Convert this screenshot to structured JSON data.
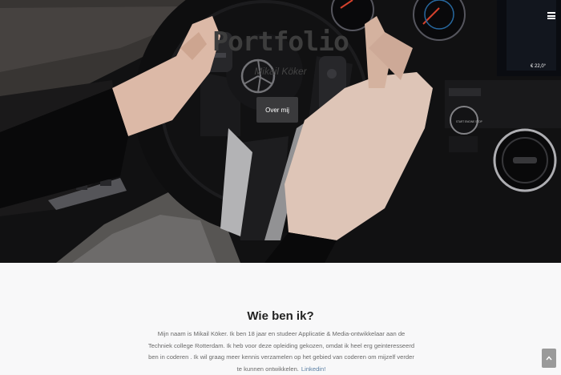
{
  "hero": {
    "title": "Portfolio",
    "subtitle": "Mikail Köker",
    "button_label": "Over mij",
    "menu_icon": "hamburger-icon"
  },
  "about": {
    "heading": "Wie ben ik?",
    "text": "Mijn naam is Mikail Köker. Ik ben 18 jaar en studeer Applicatie & Media-ontwikkelaar aan de Techniek college Rotterdam. Ik heb voor deze opleiding gekozen, omdat ik heel erg geinteresseerd ben in coderen . Ik wil graag meer kennis verzamelen op het gebied van coderen om mijzelf verder te kunnen ontwikkelen.",
    "link_label": "Linkedin!"
  },
  "dashboard": {
    "temperature": "€ 22,0°",
    "start_button": "START ENGINE STOP"
  },
  "scroll_top_icon": "chevron-up-icon",
  "colors": {
    "hero_bg": "#0d0d0f",
    "button_bg": "#3a3a3c",
    "about_bg": "#f8f8f9",
    "link": "#5b7fa3"
  }
}
